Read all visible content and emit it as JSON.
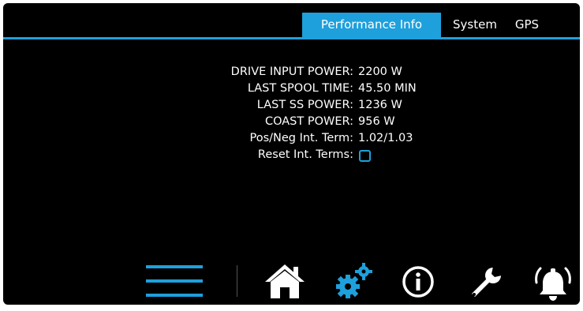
{
  "tabs": [
    {
      "label": "Performance Info",
      "active": true
    },
    {
      "label": "System",
      "active": false
    },
    {
      "label": "GPS",
      "active": false
    }
  ],
  "info": {
    "drive_input_power": {
      "label": "DRIVE INPUT POWER:",
      "value": "2200 W"
    },
    "last_spool_time": {
      "label": "LAST SPOOL TIME:",
      "value": "45.50 MIN"
    },
    "last_ss_power": {
      "label": "LAST SS POWER:",
      "value": "1236 W"
    },
    "coast_power": {
      "label": "COAST POWER:",
      "value": "956 W"
    },
    "int_term": {
      "label": "Pos/Neg Int. Term:",
      "value": "1.02/1.03"
    },
    "reset_int_terms": {
      "label": "Reset Int. Terms:",
      "checked": false
    }
  },
  "nav": {
    "items": [
      {
        "icon": "menu-icon",
        "active": true
      },
      {
        "icon": "home-icon",
        "active": false
      },
      {
        "icon": "gears-icon",
        "active": true
      },
      {
        "icon": "info-icon",
        "active": false
      },
      {
        "icon": "wrench-icon",
        "active": false
      },
      {
        "icon": "alarm-bell-icon",
        "active": false
      }
    ]
  },
  "colors": {
    "background": "#000000",
    "accent": "#1ea0dc",
    "text": "#ffffff"
  }
}
